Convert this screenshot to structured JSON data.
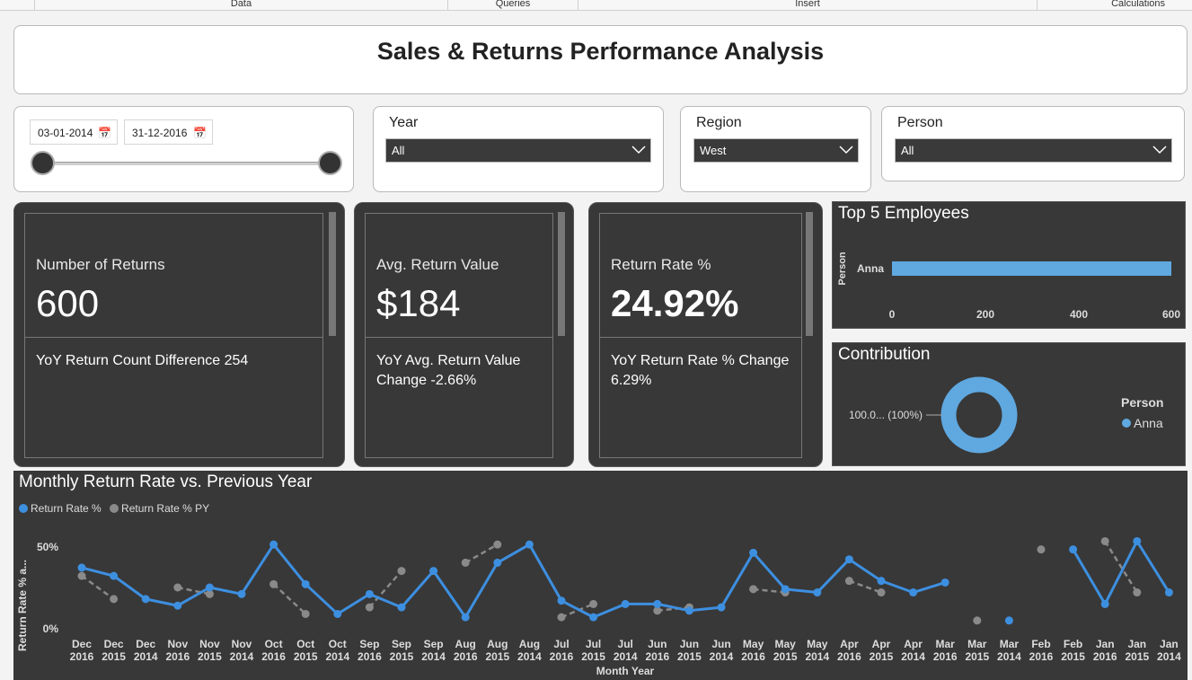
{
  "ribbon": {
    "tabs": [
      "Data",
      "Queries",
      "Insert",
      "Calculations"
    ]
  },
  "title": "Sales & Returns Performance Analysis",
  "date_filter": {
    "start": "03-01-2014",
    "end": "31-12-2016",
    "icon": "calendar-icon"
  },
  "slicers": {
    "year": {
      "label": "Year",
      "value": "All"
    },
    "region": {
      "label": "Region",
      "value": "West"
    },
    "person": {
      "label": "Person",
      "value": "All"
    }
  },
  "cards": [
    {
      "label": "Number of Returns",
      "value": "600",
      "sub": "YoY Return Count Difference 254"
    },
    {
      "label": "Avg. Return Value",
      "value": "$184",
      "sub": "YoY Avg. Return Value Change -2.66%"
    },
    {
      "label": "Return Rate %",
      "value": "24.92%",
      "sub": "YoY Return Rate % Change 6.29%"
    }
  ],
  "top_employees": {
    "title": "Top 5 Employees",
    "axis_label": "Person",
    "ticks": [
      "0",
      "200",
      "400",
      "600"
    ]
  },
  "contribution": {
    "title": "Contribution",
    "data_label": "100.0... (100%)",
    "legend_title": "Person",
    "legend_item": "Anna"
  },
  "monthly": {
    "title": "Monthly Return Rate vs. Previous Year",
    "legend": [
      "Return Rate %",
      "Return Rate % PY"
    ],
    "ylabel": "Return Rate % a...",
    "xlabel": "Month Year",
    "yticks": [
      "50%",
      "0%"
    ]
  },
  "colors": {
    "accent": "#3d8fe0",
    "py": "#8a8a8a",
    "bar": "#5fa8e0",
    "dark_bg": "#383838"
  },
  "chart_data": [
    {
      "type": "bar",
      "title": "Top 5 Employees",
      "ylabel": "Person",
      "categories": [
        "Anna"
      ],
      "values": [
        600
      ],
      "xlim": [
        0,
        600
      ]
    },
    {
      "type": "pie",
      "title": "Contribution",
      "categories": [
        "Anna"
      ],
      "values": [
        100
      ]
    },
    {
      "type": "line",
      "title": "Monthly Return Rate vs. Previous Year",
      "xlabel": "Month Year",
      "ylabel": "Return Rate % a...",
      "ylim": [
        0,
        55
      ],
      "categories": [
        "Dec 2016",
        "Dec 2015",
        "Dec 2014",
        "Nov 2016",
        "Nov 2015",
        "Nov 2014",
        "Oct 2016",
        "Oct 2015",
        "Oct 2014",
        "Sep 2016",
        "Sep 2015",
        "Sep 2014",
        "Aug 2016",
        "Aug 2015",
        "Aug 2014",
        "Jul 2016",
        "Jul 2015",
        "Jul 2014",
        "Jun 2016",
        "Jun 2015",
        "Jun 2014",
        "May 2016",
        "May 2015",
        "May 2014",
        "Apr 2016",
        "Apr 2015",
        "Apr 2014",
        "Mar 2016",
        "Mar 2015",
        "Mar 2014",
        "Feb 2016",
        "Feb 2015",
        "Jan 2016",
        "Jan 2015",
        "Jan 2014"
      ],
      "series": [
        {
          "name": "Return Rate %",
          "values": [
            37,
            32,
            18,
            14,
            25,
            21,
            51,
            27,
            9,
            21,
            13,
            35,
            7,
            40,
            51,
            17,
            7,
            15,
            15,
            11,
            13,
            46,
            24,
            22,
            42,
            29,
            22,
            28,
            null,
            5,
            null,
            48,
            15,
            53,
            22
          ]
        },
        {
          "name": "Return Rate % PY",
          "values": [
            32,
            18,
            null,
            25,
            21,
            null,
            27,
            9,
            null,
            13,
            35,
            null,
            40,
            51,
            null,
            7,
            15,
            null,
            11,
            13,
            null,
            24,
            22,
            null,
            29,
            22,
            null,
            null,
            5,
            null,
            48,
            null,
            53,
            22,
            null
          ]
        }
      ]
    }
  ]
}
